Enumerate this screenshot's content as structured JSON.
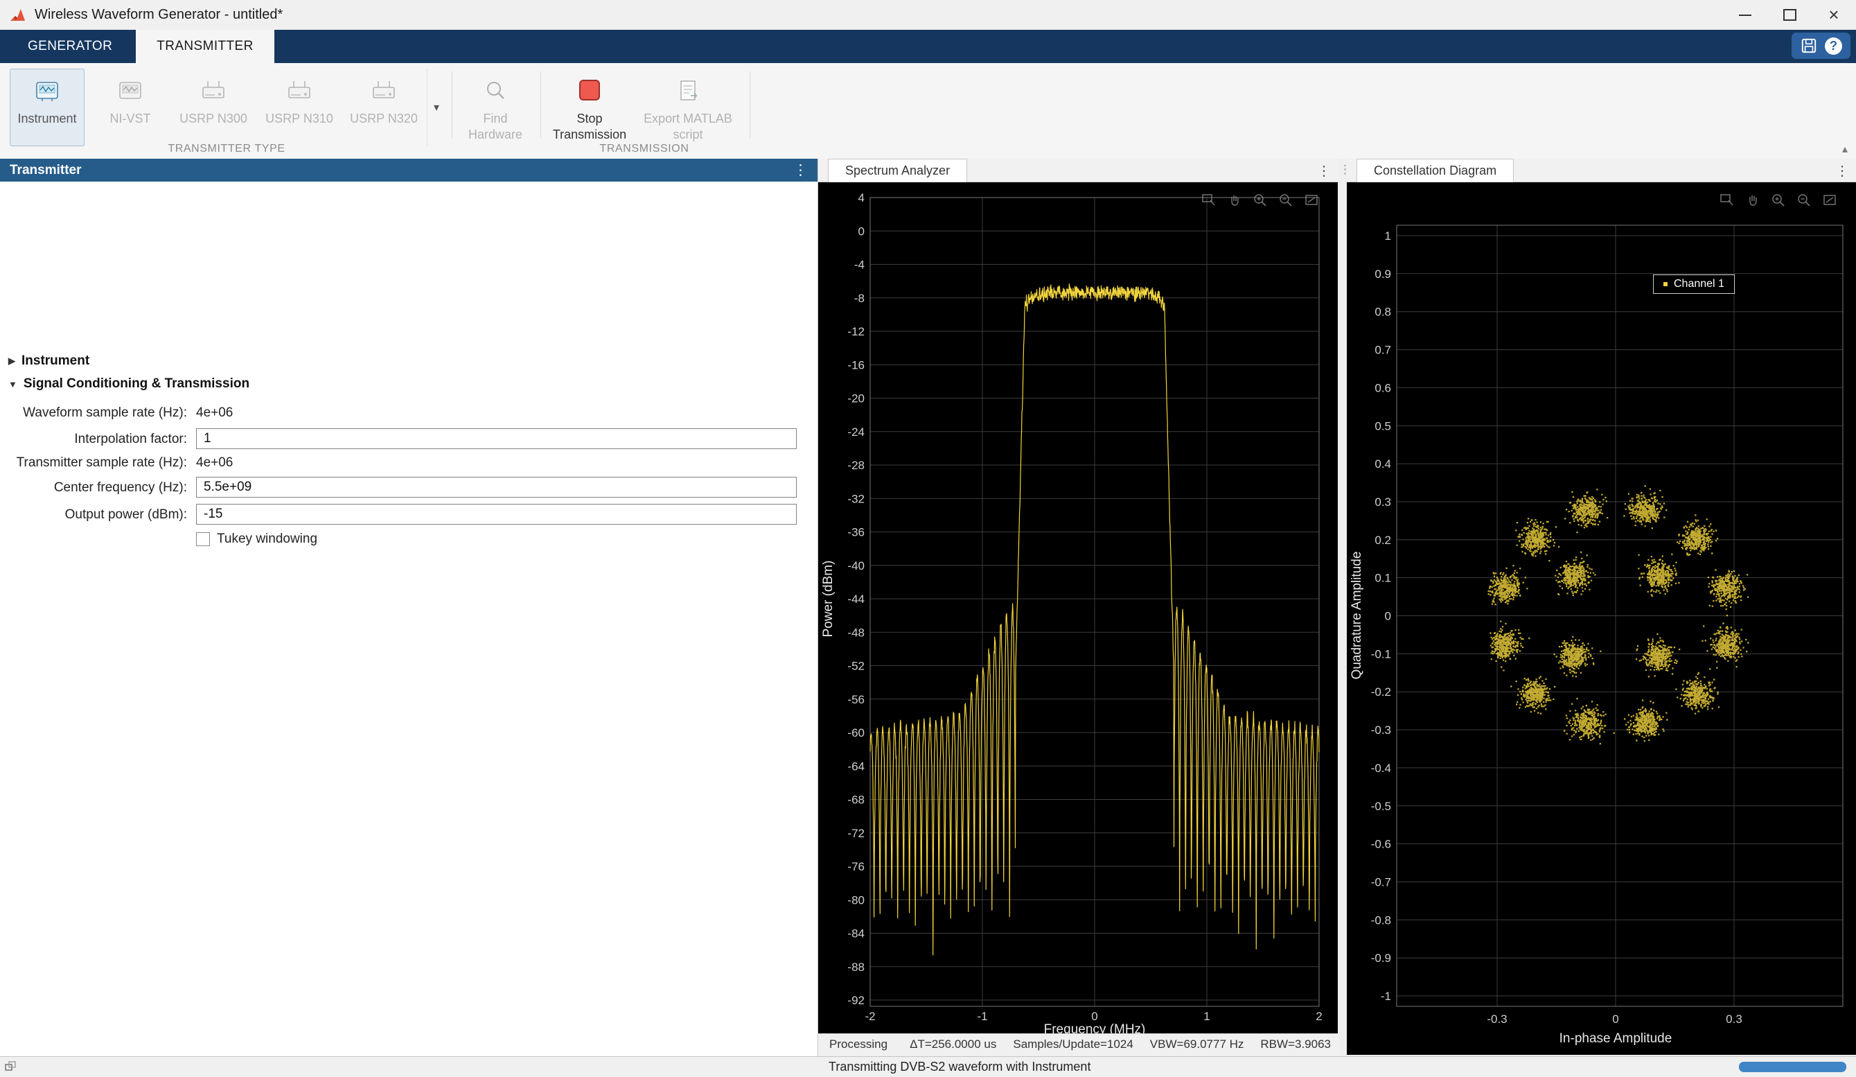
{
  "window": {
    "title": "Wireless Waveform Generator - untitled*"
  },
  "ribbon": {
    "tabs": [
      {
        "label": "GENERATOR",
        "active": false
      },
      {
        "label": "TRANSMITTER",
        "active": true
      }
    ]
  },
  "icons": {
    "menu": "⋮",
    "dropdown": "▾",
    "ribbon_collapse": "▴",
    "section_collapsed": "▶",
    "section_expanded": "▼",
    "help": "?",
    "close": "×"
  },
  "toolbar": {
    "transmitter_type": {
      "label": "TRANSMITTER TYPE",
      "items": [
        {
          "label": "Instrument",
          "state": "selected"
        },
        {
          "label": "NI-VST",
          "state": "disabled"
        },
        {
          "label": "USRP N300",
          "state": "disabled"
        },
        {
          "label": "USRP N310",
          "state": "disabled"
        },
        {
          "label": "USRP N320",
          "state": "disabled"
        }
      ]
    },
    "find_hardware": {
      "label": "Find Hardware",
      "state": "disabled"
    },
    "transmission": {
      "label": "TRANSMISSION",
      "stop_label": "Stop Transmission",
      "export_label": "Export MATLAB script",
      "export_state": "disabled"
    }
  },
  "left_panel": {
    "header": "Transmitter",
    "sections": [
      {
        "label": "Instrument",
        "collapsed": true
      },
      {
        "label": "Signal Conditioning & Transmission",
        "collapsed": false
      }
    ],
    "fields": [
      {
        "label": "Waveform sample rate (Hz):",
        "value": "4e+06",
        "type": "static"
      },
      {
        "label": "Interpolation factor:",
        "value": "1",
        "type": "input"
      },
      {
        "label": "Transmitter sample rate (Hz):",
        "value": "4e+06",
        "type": "static"
      },
      {
        "label": "Center frequency (Hz):",
        "value": "5.5e+09",
        "type": "input"
      },
      {
        "label": "Output power (dBm):",
        "value": "-15",
        "type": "input"
      }
    ],
    "tukey": {
      "label": "Tukey windowing",
      "checked": false
    }
  },
  "status_bar": {
    "message": "Transmitting DVB-S2 waveform with Instrument"
  },
  "chart_data": [
    {
      "type": "line",
      "panel": "spectrum-analyzer",
      "tab": "Spectrum Analyzer",
      "xlabel": "Frequency (MHz)",
      "ylabel": "Power (dBm)",
      "xlim": [
        -2,
        2
      ],
      "ylim": [
        -92,
        4
      ],
      "xticks": [
        -2,
        -1,
        0,
        1,
        2
      ],
      "yticks": [
        4,
        0,
        -4,
        -8,
        -12,
        -16,
        -20,
        -24,
        -28,
        -32,
        -36,
        -40,
        -44,
        -48,
        -52,
        -56,
        -60,
        -64,
        -68,
        -72,
        -76,
        -80,
        -84,
        -88,
        -92
      ],
      "grid": true,
      "line_color": "#f2d43d",
      "series_desc": {
        "description": "DVB-S2 transmitted spectrum: flat passband near -7.5 dBm from -0.62 to 0.62 MHz, steep rolloff, periodic sinc sidelobes decaying from about -45 dBm to -60 dBm, nulls near -86 dBm",
        "passband_level_dbm": -7.4,
        "passband_halfwidth_mhz": 0.62,
        "transition_end_mhz": 0.705,
        "sidelobe_period_mhz": 0.0525,
        "sidelobe_peak_near_dbm": -45,
        "sidelobe_peak_far_dbm": -60,
        "null_floor_dbm": -86
      },
      "status": {
        "state": "Processing",
        "delta_t": "ΔT=256.0000 us",
        "samples_per_update": "Samples/Update=1024",
        "vbw": "VBW=69.0777 Hz",
        "rbw": "RBW=3.9063"
      }
    },
    {
      "type": "scatter",
      "panel": "constellation-diagram",
      "tab": "Constellation Diagram",
      "xlabel": "In-phase Amplitude",
      "ylabel": "Quadrature Amplitude",
      "xlim": [
        -0.554,
        0.576
      ],
      "ylim": [
        -1.028,
        1.028
      ],
      "xticks": [
        -0.3,
        0,
        0.3
      ],
      "yticks": [
        1,
        0.9,
        0.8,
        0.7,
        0.6,
        0.5,
        0.4,
        0.3,
        0.2,
        0.1,
        0,
        -0.1,
        -0.2,
        -0.3,
        -0.4,
        -0.5,
        -0.6,
        -0.7,
        -0.8,
        -0.9,
        -1
      ],
      "grid": true,
      "marker_color": "#f2d43d",
      "legend": {
        "label": "Channel 1",
        "position": "northeast"
      },
      "constellation": {
        "modulation": "16APSK",
        "inner_radius": 0.15,
        "inner_angles_deg": [
          45,
          135,
          225,
          315
        ],
        "outer_radius": 0.29,
        "outer_angles_deg": [
          15,
          45,
          75,
          105,
          135,
          165,
          195,
          225,
          255,
          285,
          315,
          345
        ],
        "cluster_sigma": 0.019
      }
    }
  ]
}
